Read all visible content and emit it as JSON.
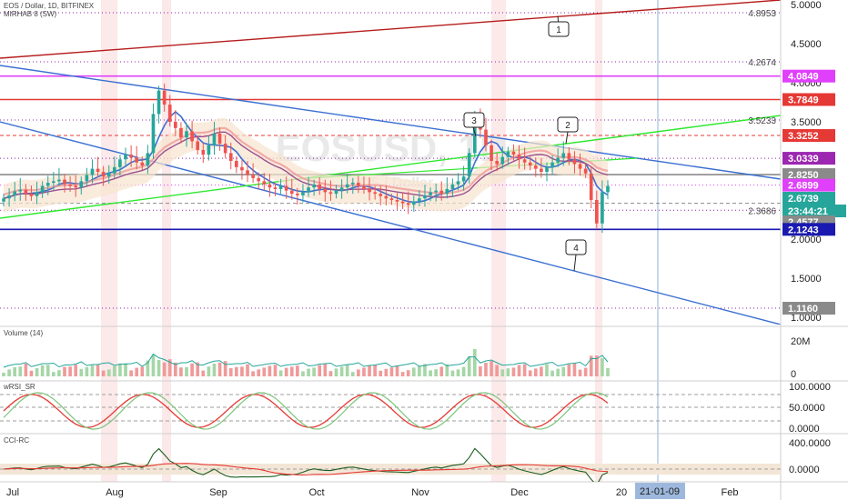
{
  "header": {
    "symbol_line": "EOS / Dollar, 1D, BITFINEX",
    "indicator_line": "MIRHAB 8 (SW)"
  },
  "watermark": {
    "symbol": "EOSUSD, 1D",
    "description": "EOS / Dollar"
  },
  "panes": {
    "volume": {
      "title": "Volume (14)",
      "ticks": [
        "20M",
        "0"
      ]
    },
    "wrsi": {
      "title": "wRSI_SR",
      "ticks": [
        "100.0000",
        "50.0000",
        "0.0000"
      ]
    },
    "cci": {
      "title": "CCI-RC",
      "ticks": [
        "400.0000",
        "0.0000"
      ]
    }
  },
  "colors": {
    "up": "#26a69a",
    "down": "#ef5350",
    "blue_line": "#3b6fd1",
    "green_line": "#2ee82e",
    "red_line": "#c62828",
    "fib_dotted": "#8e24aa",
    "navy_line": "#1a1ab0"
  },
  "chart_data": [
    {
      "type": "candlestick",
      "title": "EOS / Dollar, 1D, BITFINEX",
      "ylim": [
        0.95,
        5.0
      ],
      "y_ticks": [
        "5.0000",
        "4.5000",
        "4.0000",
        "3.5000",
        "3.0000",
        "2.5000",
        "2.0000",
        "1.5000",
        "1.0000"
      ],
      "y_tick_values": [
        5.0,
        4.5,
        4.0,
        3.5,
        3.0,
        2.5,
        2.0,
        1.5,
        1.0
      ],
      "x_ticks": [
        "Jul",
        "Aug",
        "Sep",
        "Oct",
        "Nov",
        "Dec",
        "20",
        "Feb"
      ],
      "cursor_date": "21-01-09",
      "price_tags": [
        {
          "label": "4.0849",
          "value": 4.0849,
          "color": "#e040fb"
        },
        {
          "label": "3.7849",
          "value": 3.7849,
          "color": "#e53935"
        },
        {
          "label": "3.3252",
          "value": 3.3252,
          "color": "#e53935"
        },
        {
          "label": "3.0339",
          "value": 3.0339,
          "color": "#9c27b0"
        },
        {
          "label": "2.8250",
          "value": 2.825,
          "color": "#8a8a8a"
        },
        {
          "label": "2.6899",
          "value": 2.6899,
          "color": "#e040fb"
        },
        {
          "label": "2.6739",
          "value": 2.6739,
          "color": "#26a69a"
        },
        {
          "label": "23:44:21",
          "value": 2.55,
          "color": "#26a69a"
        },
        {
          "label": "2.4577",
          "value": 2.4577,
          "color": "#8a8a8a"
        },
        {
          "label": "2.1243",
          "value": 2.1243,
          "color": "#1a1ab0"
        },
        {
          "label": "1.1160",
          "value": 1.116,
          "color": "#8a8a8a"
        }
      ],
      "fib_labels": [
        {
          "label": "4.8953",
          "value": 4.8953
        },
        {
          "label": "4.2674",
          "value": 4.2674
        },
        {
          "label": "3.5233",
          "value": 3.5233
        },
        {
          "label": "2.3686",
          "value": 2.3686
        }
      ],
      "horizontal_levels": [
        {
          "value": 4.8953,
          "style": "dotted",
          "color": "#8e24aa"
        },
        {
          "value": 4.2674,
          "style": "dotted",
          "color": "#8e24aa"
        },
        {
          "value": 4.0849,
          "style": "solid",
          "color": "#e040fb"
        },
        {
          "value": 3.7849,
          "style": "solid",
          "color": "#e53935"
        },
        {
          "value": 3.5233,
          "style": "dotted",
          "color": "#8e24aa"
        },
        {
          "value": 3.3252,
          "style": "dashed",
          "color": "#e53935"
        },
        {
          "value": 3.0339,
          "style": "dotted",
          "color": "#8e24aa"
        },
        {
          "value": 2.825,
          "style": "solid",
          "color": "#8a8a8a"
        },
        {
          "value": 2.6899,
          "style": "dotted",
          "color": "#e040fb"
        },
        {
          "value": 2.4577,
          "style": "dashed",
          "color": "#8a8a8a"
        },
        {
          "value": 2.3686,
          "style": "dotted",
          "color": "#8e24aa"
        },
        {
          "value": 2.1243,
          "style": "solid",
          "color": "#1a1ab0"
        },
        {
          "value": 1.116,
          "style": "dotted",
          "color": "#8e24aa"
        }
      ],
      "callouts": [
        {
          "label": "1"
        },
        {
          "label": "2"
        },
        {
          "label": "3"
        },
        {
          "label": "4"
        }
      ],
      "closes": [
        2.52,
        2.56,
        2.61,
        2.63,
        2.58,
        2.55,
        2.6,
        2.68,
        2.72,
        2.74,
        2.76,
        2.7,
        2.68,
        2.66,
        2.74,
        2.82,
        2.9,
        2.86,
        2.8,
        2.84,
        2.92,
        3.02,
        3.08,
        3.04,
        2.98,
        2.94,
        3.1,
        3.6,
        3.9,
        3.72,
        3.5,
        3.42,
        3.3,
        3.38,
        3.25,
        3.14,
        3.08,
        3.2,
        3.35,
        3.22,
        3.1,
        3.0,
        2.92,
        2.88,
        2.82,
        2.78,
        2.74,
        2.7,
        2.66,
        2.64,
        2.68,
        2.62,
        2.58,
        2.56,
        2.6,
        2.66,
        2.7,
        2.64,
        2.6,
        2.58,
        2.62,
        2.66,
        2.7,
        2.72,
        2.68,
        2.64,
        2.6,
        2.58,
        2.55,
        2.52,
        2.5,
        2.48,
        2.46,
        2.44,
        2.48,
        2.52,
        2.56,
        2.6,
        2.62,
        2.58,
        2.64,
        2.7,
        2.74,
        2.8,
        3.1,
        3.55,
        3.4,
        3.2,
        3.0,
        2.96,
        3.05,
        3.12,
        3.08,
        3.02,
        2.98,
        2.94,
        2.9,
        2.86,
        2.92,
        2.98,
        3.04,
        3.1,
        3.02,
        2.96,
        2.9,
        2.84,
        2.5,
        2.2,
        2.6,
        2.68
      ]
    },
    {
      "type": "bar",
      "title": "Volume (14)",
      "y_ticks": [
        "20M",
        "0"
      ]
    },
    {
      "type": "line",
      "title": "wRSI_SR",
      "y_ticks": [
        "100.0000",
        "50.0000",
        "0.0000"
      ],
      "ylim": [
        0,
        100
      ]
    },
    {
      "type": "line",
      "title": "CCI-RC",
      "y_ticks": [
        "400.0000",
        "0.0000"
      ]
    }
  ]
}
